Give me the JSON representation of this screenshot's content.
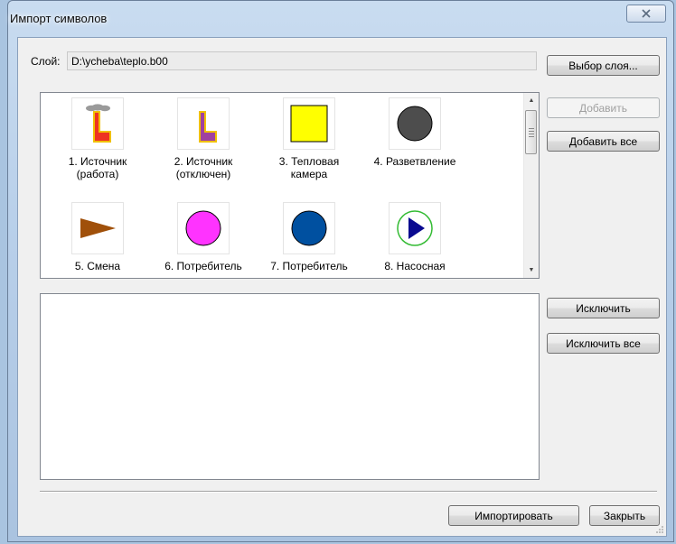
{
  "window": {
    "title": "Импорт символов",
    "close_glyph": "X"
  },
  "layer": {
    "label": "Слой:",
    "path": "D:\\ycheba\\teplo.b00",
    "select_button": "Выбор слоя..."
  },
  "actions": {
    "add": "Добавить",
    "add_all": "Добавить все",
    "exclude": "Исключить",
    "exclude_all": "Исключить все",
    "import": "Импортировать",
    "close": "Закрыть"
  },
  "symbols": [
    {
      "label_line1": "1. Источник",
      "label_line2": "(работа)",
      "icon": "source-working-icon"
    },
    {
      "label_line1": "2. Источник",
      "label_line2": "(отключен)",
      "icon": "source-disabled-icon"
    },
    {
      "label_line1": "3. Тепловая",
      "label_line2": "камера",
      "icon": "yellow-square-icon"
    },
    {
      "label_line1": "4. Разветвление",
      "label_line2": "",
      "icon": "gray-circle-icon"
    },
    {
      "label_line1": "5. Смена",
      "label_line2": "",
      "icon": "brown-triangle-icon"
    },
    {
      "label_line1": "6. Потребитель",
      "label_line2": "",
      "icon": "magenta-circle-icon"
    },
    {
      "label_line1": "7. Потребитель",
      "label_line2": "",
      "icon": "blue-circle-icon"
    },
    {
      "label_line1": "8. Насосная",
      "label_line2": "",
      "icon": "pump-icon"
    }
  ],
  "colors": {
    "source_fill": "#ee3322",
    "source_outline": "#f0c000",
    "smoke": "#9a9a9a",
    "disabled_fill": "#a040a0",
    "yellow": "#ffff00",
    "gray_circle": "#4d4d4d",
    "brown": "#a0500a",
    "magenta": "#ff33ff",
    "blue": "#0050a0",
    "pump_ring": "#33bb33",
    "pump_arrow": "#0a0a90"
  }
}
